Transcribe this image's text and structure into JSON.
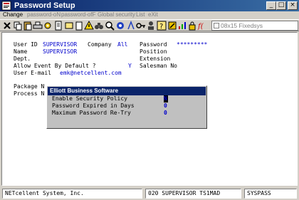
{
  "window": {
    "title": "Password Setup"
  },
  "menu": [
    {
      "label": "Change",
      "enabled": true
    },
    {
      "label": "password-oN",
      "enabled": false
    },
    {
      "label": "password-ofF",
      "enabled": false
    },
    {
      "label": "Global security",
      "enabled": false
    },
    {
      "label": "List",
      "enabled": false
    },
    {
      "label": "eXit",
      "enabled": false
    }
  ],
  "toolbar": {
    "buttons": [
      "close-x-icon",
      "copy-icon",
      "paste-icon",
      "print-icon",
      "settings-gear-icon",
      "document-icon",
      "folder-icon",
      "clipboard-icon",
      "warning-icon",
      "binoculars-icon",
      "magnify-icon",
      "gear-icon",
      "compass-icon",
      "key-icon",
      "user-icon",
      "help-question-icon",
      "tools-icon",
      "chart-icon",
      "lock-icon",
      "function-icon",
      "info-icon",
      "calculator-icon"
    ],
    "font_select": "08x15 Fixedsys"
  },
  "form": {
    "user_id_label": "User ID",
    "user_id": "SUPERVISOR",
    "company_label": "Company",
    "company": "All",
    "password_label": "Password",
    "password": "*********",
    "name_label": "Name",
    "name": "SUPERVISOR",
    "position_label": "Position",
    "dept_label": "Dept.",
    "extension_label": "Extension",
    "allow_event_label": "Allow Event By Default ?",
    "allow_event": "Y",
    "salesman_label": "Salesman No",
    "email_label": "User E-mail",
    "email": "emk@netcellent.com",
    "package_label": "Package N",
    "process_label": "Process N"
  },
  "dialog": {
    "title": "Elliott Business Software",
    "rows": [
      {
        "label": "Enable Security Policy",
        "value": "N"
      },
      {
        "label": "Password Expired in Days",
        "value": "0"
      },
      {
        "label": "Maximum Password Re-Try",
        "value": "0"
      }
    ]
  },
  "status": {
    "company": "NETcellent System, Inc.",
    "info": "020 SUPERVISOR TS1MAD",
    "program": "SYSPASS"
  }
}
